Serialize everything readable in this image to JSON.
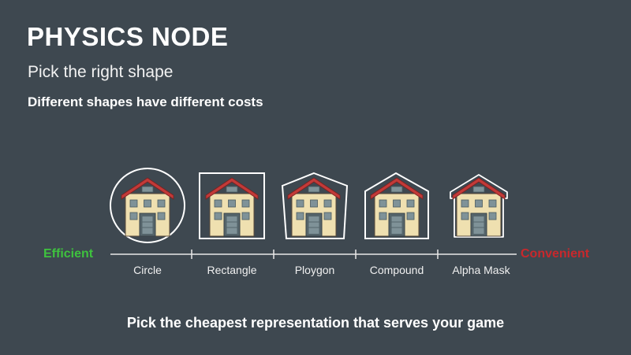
{
  "slide": {
    "title": "PHYSICS NODE",
    "subtitle": "Pick the right shape",
    "subheading": "Different shapes have different costs",
    "footer": "Pick the cheapest representation that serves your game"
  },
  "scale": {
    "left_label": "Efficient",
    "right_label": "Convenient",
    "left_color": "#3ec23e",
    "right_color": "#c8282c"
  },
  "shapes": [
    {
      "label": "Circle",
      "outline": "circle"
    },
    {
      "label": "Rectangle",
      "outline": "rectangle"
    },
    {
      "label": "Ploygon",
      "outline": "polygon"
    },
    {
      "label": "Compound",
      "outline": "compound"
    },
    {
      "label": "Alpha Mask",
      "outline": "alpha-mask"
    }
  ],
  "colors": {
    "background": "#3e4850",
    "house_wall": "#efe0b0",
    "house_roof": "#c23a38",
    "house_trim": "#ffffff",
    "window": "#7f9298",
    "door": "#55656b"
  }
}
